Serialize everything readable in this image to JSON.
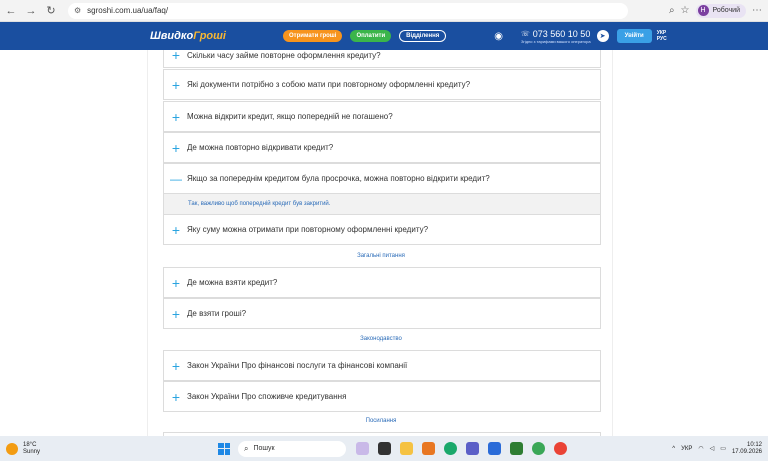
{
  "browser": {
    "url": "sgroshi.com.ua/ua/faq/",
    "profile_initial": "Н",
    "profile_name": "Робочий"
  },
  "header": {
    "logo_main": "Швидко",
    "logo_accent": "Гроші",
    "btn_get_money": "Отримати гроші",
    "btn_pay": "Оплатити",
    "btn_branches": "Відділення",
    "phone": "073 560 10 50",
    "phone_sub": "Згідно з тарифами вашого оператора",
    "login": "Увійти",
    "lang_ua": "УКР",
    "lang_ru": "РУС"
  },
  "faq": {
    "q1": "Скільки часу займе повторне оформлення кредиту?",
    "q2": "Які документи потрібно з собою мати при повторному оформленні кредиту?",
    "q3": "Можна відкрити кредит, якщо попередній не погашено?",
    "q4": "Де можна повторно відкривати кредит?",
    "q5": "Якщо за попереднім кредитом була просрочка, можна повторно відкрити кредит?",
    "a5": "Так, важливо щоб попередній кредит був закритий.",
    "q6": "Яку суму можна отримати при повторному оформленні кредиту?",
    "section_general": "Загальні питання",
    "q7": "Де можна взяти кредит?",
    "q8": "Де взяти гроші?",
    "section_law": "Законодавство",
    "q9": "Закон України Про фінансові послуги та фінансові компанії",
    "q10": "Закон України Про споживче кредитування",
    "section_links": "Посилання"
  },
  "taskbar": {
    "temp": "18°C",
    "weather": "Sunny",
    "search": "Пошук",
    "lang": "УКР",
    "time": "10:12",
    "date": "17.09.2026"
  }
}
